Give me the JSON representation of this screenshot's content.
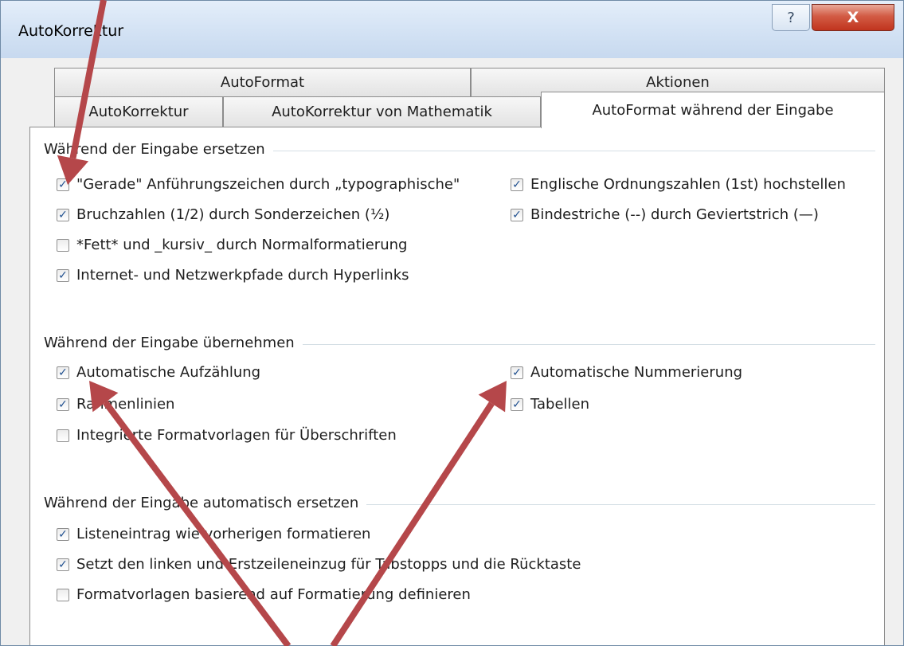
{
  "window": {
    "title": "AutoKorrektur",
    "help_label": "?",
    "close_label": "X"
  },
  "tabs": {
    "back_row": [
      "AutoFormat",
      "Aktionen"
    ],
    "front_row": [
      "AutoKorrektur",
      "AutoKorrektur von Mathematik",
      "AutoFormat während der Eingabe"
    ],
    "active": "AutoFormat während der Eingabe"
  },
  "groups": {
    "replace": {
      "label": "Während der Eingabe ersetzen",
      "left": [
        {
          "label": "\"Gerade\" Anführungszeichen durch „typographische\"",
          "checked": true
        },
        {
          "label": "Bruchzahlen (1/2) durch Sonderzeichen (½)",
          "checked": true
        },
        {
          "label": "*Fett* und _kursiv_ durch Normalformatierung",
          "checked": false
        },
        {
          "label": "Internet- und Netzwerkpfade durch Hyperlinks",
          "checked": true
        }
      ],
      "right": [
        {
          "label": "Englische Ordnungszahlen (1st) hochstellen",
          "checked": true
        },
        {
          "label": "Bindestriche (--) durch Geviertstrich (—)",
          "checked": true
        }
      ]
    },
    "apply": {
      "label": "Während der Eingabe übernehmen",
      "left": [
        {
          "label": "Automatische Aufzählung",
          "checked": true
        },
        {
          "label": "Rahmenlinien",
          "checked": true
        },
        {
          "label": "Integrierte Formatvorlagen für Überschriften",
          "checked": false
        }
      ],
      "right": [
        {
          "label": "Automatische Nummerierung",
          "checked": true
        },
        {
          "label": "Tabellen",
          "checked": true
        }
      ]
    },
    "auto": {
      "label": "Während der Eingabe automatisch ersetzen",
      "left": [
        {
          "label": "Listeneintrag wie vorherigen formatieren",
          "checked": true
        },
        {
          "label": "Setzt den linken und Erstzeileneinzug für Tabstopps und die Rücktaste",
          "checked": true
        },
        {
          "label": "Formatvorlagen basierend auf Formatierung definieren",
          "checked": false
        }
      ]
    }
  },
  "colors": {
    "annotation_arrow": "#b5474a",
    "checkmark": "#1f4f8f",
    "close_button": "#c7432c"
  }
}
